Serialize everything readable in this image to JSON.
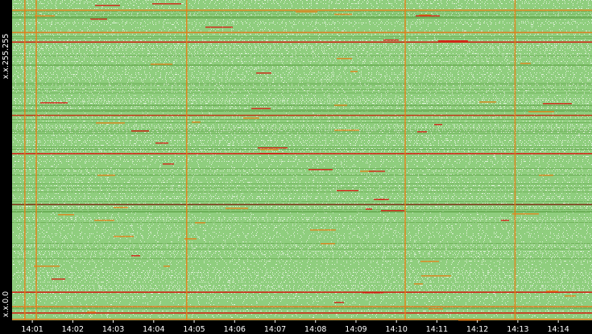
{
  "chart_data": {
    "type": "heatmap",
    "title": "",
    "xlabel": "",
    "ylabel": "",
    "x_ticks": [
      "14:01",
      "14:02",
      "14:03",
      "14:04",
      "14:05",
      "14:06",
      "14:07",
      "14:08",
      "14:09",
      "14:10",
      "14:11",
      "14:12",
      "14:13",
      "14:14"
    ],
    "y_ticks": [
      "x.x.0.0",
      "x.x.255.255"
    ],
    "x_range": [
      "14:00:30",
      "14:14:50"
    ],
    "y_range": [
      "x.x.0.0",
      "x.x.255.255"
    ],
    "grid": false,
    "legend": "none",
    "colors": {
      "background": "#8fce7e",
      "sparse": "#ffffff",
      "dense": "#d8120a",
      "medium": "#e67e14",
      "frame": "#000000",
      "text": "#ffffff"
    },
    "vertical_bursts": [
      "14:00:48",
      "14:01:05",
      "14:04:48",
      "14:10:12",
      "14:12:55"
    ],
    "horizontal_bands": [
      {
        "position": 0.0,
        "color": "#e2771a"
      },
      {
        "position": 0.02,
        "color": "#d8120a"
      },
      {
        "position": 0.04,
        "color": "#e2771a"
      },
      {
        "position": 0.085,
        "color": "#d8120a"
      },
      {
        "position": 0.36,
        "color": "#7a2a10"
      },
      {
        "position": 0.52,
        "color": "#d8120a"
      },
      {
        "position": 0.64,
        "color": "#c03010"
      },
      {
        "position": 0.87,
        "color": "#d8120a"
      },
      {
        "position": 0.9,
        "color": "#e2771a"
      },
      {
        "position": 0.97,
        "color": "#e67e14"
      }
    ]
  }
}
